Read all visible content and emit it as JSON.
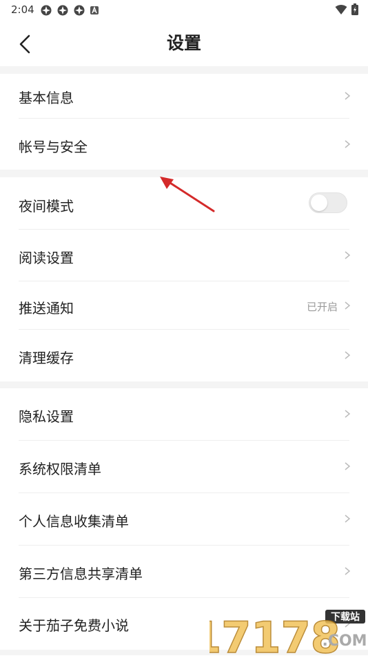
{
  "status_bar": {
    "time": "2:04",
    "battery_icon": "battery-icon",
    "wifi_icon": "wifi-icon"
  },
  "header": {
    "title": "设置",
    "back_icon": "chevron-left-icon"
  },
  "sections": [
    {
      "items": [
        {
          "label": "基本信息"
        },
        {
          "label": "帐号与安全"
        }
      ]
    },
    {
      "items": [
        {
          "label": "夜间模式",
          "toggle": false
        },
        {
          "label": "阅读设置"
        },
        {
          "label": "推送通知",
          "value": "已开启"
        },
        {
          "label": "清理缓存"
        }
      ]
    },
    {
      "items": [
        {
          "label": "隐私设置"
        },
        {
          "label": "系统权限清单"
        },
        {
          "label": "个人信息收集清单"
        },
        {
          "label": "第三方信息共享清单"
        },
        {
          "label": "关于茄子免费小说"
        }
      ]
    }
  ],
  "watermark": {
    "number": "17178",
    "badge": "下载站",
    "domain": ".COM"
  },
  "colors": {
    "background": "#ffffff",
    "section_gap": "#f4f4f4",
    "text": "#222222",
    "secondary_text": "#999999",
    "annotation_arrow": "#d42a2a"
  }
}
